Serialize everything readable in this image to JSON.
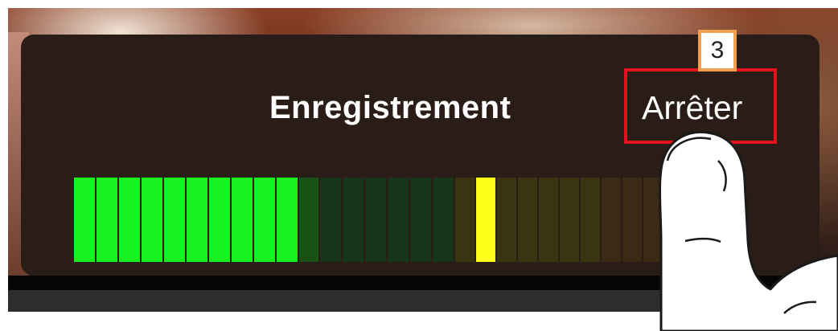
{
  "recording_panel": {
    "title": "Enregistrement",
    "stop_label": "Arrêter"
  },
  "annotation": {
    "step_number": "3"
  },
  "level_meter": {
    "active_green_segments": 10,
    "peak_segment_index": 18,
    "colors": {
      "green_on": "#17f21e",
      "green_off": "#173518",
      "yellow_peak": "#ffff1a",
      "highlight_box": "#e0121b",
      "badge_border": "#f0a050"
    }
  }
}
